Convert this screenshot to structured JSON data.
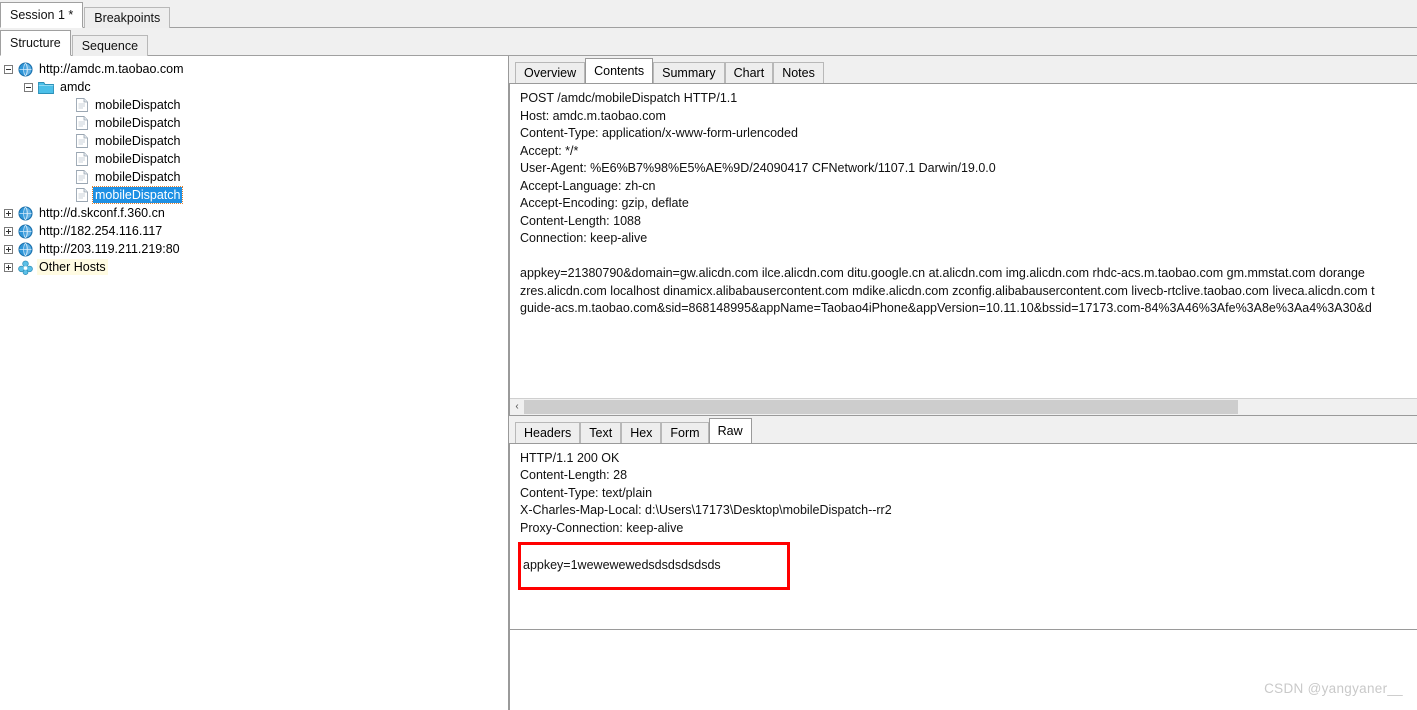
{
  "window": {
    "session_tabs": [
      {
        "label": "Session 1 *",
        "active": true
      },
      {
        "label": "Breakpoints",
        "active": false
      }
    ],
    "view_tabs": [
      {
        "label": "Structure",
        "active": true
      },
      {
        "label": "Sequence",
        "active": false
      }
    ]
  },
  "tree": {
    "nodes": [
      {
        "label": "http://amdc.m.taobao.com",
        "icon": "globe-icon",
        "indent": 0,
        "expander": "minus",
        "state": "expanded"
      },
      {
        "label": "amdc",
        "icon": "folder-icon",
        "indent": 1,
        "expander": "minus",
        "state": "expanded"
      },
      {
        "label": "mobileDispatch",
        "icon": "document-icon",
        "indent": 2,
        "expander": "none",
        "state": "normal"
      },
      {
        "label": "mobileDispatch",
        "icon": "document-icon",
        "indent": 2,
        "expander": "none",
        "state": "normal"
      },
      {
        "label": "mobileDispatch",
        "icon": "document-icon",
        "indent": 2,
        "expander": "none",
        "state": "normal"
      },
      {
        "label": "mobileDispatch",
        "icon": "document-icon",
        "indent": 2,
        "expander": "none",
        "state": "normal"
      },
      {
        "label": "mobileDispatch",
        "icon": "document-icon",
        "indent": 2,
        "expander": "none",
        "state": "normal"
      },
      {
        "label": "mobileDispatch",
        "icon": "document-icon",
        "indent": 2,
        "expander": "none",
        "state": "selected"
      },
      {
        "label": "http://d.skconf.f.360.cn",
        "icon": "globe-icon",
        "indent": 0,
        "expander": "plus",
        "state": "normal"
      },
      {
        "label": "http://182.254.116.117",
        "icon": "globe-icon",
        "indent": 0,
        "expander": "plus",
        "state": "normal"
      },
      {
        "label": "http://203.119.211.219:80",
        "icon": "globe-icon",
        "indent": 0,
        "expander": "plus",
        "state": "normal"
      },
      {
        "label": "Other Hosts",
        "icon": "other-hosts-icon",
        "indent": 0,
        "expander": "plus",
        "state": "tinted"
      }
    ]
  },
  "detail": {
    "tabs": [
      {
        "label": "Overview",
        "active": false
      },
      {
        "label": "Contents",
        "active": true
      },
      {
        "label": "Summary",
        "active": false
      },
      {
        "label": "Chart",
        "active": false
      },
      {
        "label": "Notes",
        "active": false
      }
    ],
    "request_text": "POST /amdc/mobileDispatch HTTP/1.1\nHost: amdc.m.taobao.com\nContent-Type: application/x-www-form-urlencoded\nAccept: */*\nUser-Agent: %E6%B7%98%E5%AE%9D/24090417 CFNetwork/1107.1 Darwin/19.0.0\nAccept-Language: zh-cn\nAccept-Encoding: gzip, deflate\nContent-Length: 1088\nConnection: keep-alive\n\nappkey=21380790&domain=gw.alicdn.com ilce.alicdn.com ditu.google.cn at.alicdn.com img.alicdn.com rhdc-acs.m.taobao.com gm.mmstat.com dorange\nzres.alicdn.com localhost dinamicx.alibabausercontent.com mdike.alicdn.com zconfig.alibabausercontent.com livecb-rtclive.taobao.com liveca.alicdn.com t\nguide-acs.m.taobao.com&sid=868148995&appName=Taobao4iPhone&appVersion=10.11.10&bssid=17173.com-84%3A46%3Afe%3A8e%3Aa4%3A30&d",
    "scroll_left_arrow": "‹"
  },
  "response": {
    "tabs": [
      {
        "label": "Headers",
        "active": false
      },
      {
        "label": "Text",
        "active": false
      },
      {
        "label": "Hex",
        "active": false
      },
      {
        "label": "Form",
        "active": false
      },
      {
        "label": "Raw",
        "active": true
      }
    ],
    "headers_text": "HTTP/1.1 200 OK\nContent-Length: 28\nContent-Type: text/plain\nX-Charles-Map-Local: d:\\Users\\17173\\Desktop\\mobileDispatch--rr2\nProxy-Connection: keep-alive",
    "highlighted_body": "appkey=1wewewewedsdsdsdsdsds",
    "highlight_color": "#ff0000"
  },
  "watermark": {
    "text": "CSDN @yangyaner__"
  }
}
